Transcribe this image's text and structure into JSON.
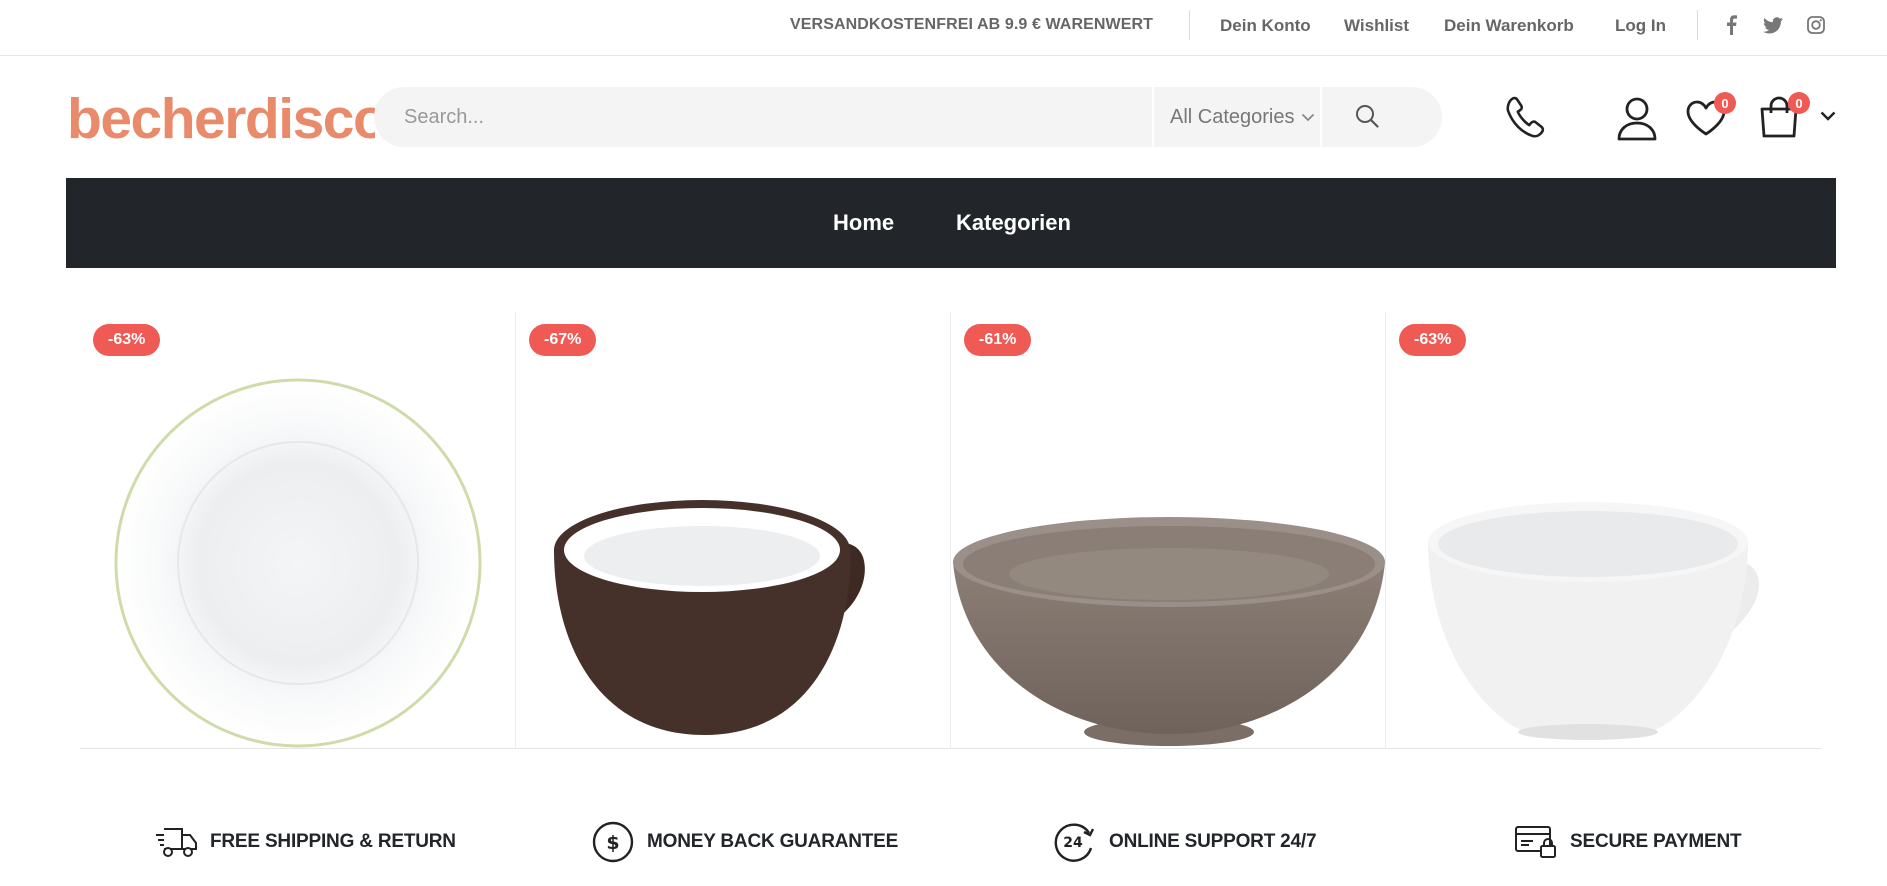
{
  "topbar": {
    "promo": "VERSANDKOSTENFREI AB 9.9 € WARENWERT",
    "links": [
      "Dein Konto",
      "Wishlist",
      "Dein Warenkorb",
      "Log In"
    ],
    "social_icons": [
      "facebook-icon",
      "twitter-icon",
      "instagram-icon"
    ]
  },
  "header": {
    "logo_text": "becherdiscount",
    "search_placeholder": "Search...",
    "category_label": "All Categories",
    "wishlist_count": "0",
    "cart_count": "0"
  },
  "nav": {
    "items": [
      "Home",
      "Kategorien"
    ]
  },
  "products": [
    {
      "discount": "-63%",
      "image": "white-deep-plate"
    },
    {
      "discount": "-67%",
      "image": "brown-cup"
    },
    {
      "discount": "-61%",
      "image": "grey-bowl"
    },
    {
      "discount": "-63%",
      "image": "white-tea-cup"
    }
  ],
  "features": [
    {
      "label": "FREE SHIPPING & RETURN",
      "icon": "truck-icon"
    },
    {
      "label": "MONEY BACK GUARANTEE",
      "icon": "dollar-icon"
    },
    {
      "label": "ONLINE SUPPORT 24/7",
      "icon": "support-24-icon"
    },
    {
      "label": "SECURE PAYMENT",
      "icon": "secure-payment-icon"
    }
  ],
  "colors": {
    "accent": "#ef5a55",
    "logo": "#e98a6b",
    "nav_bg": "#222529"
  }
}
